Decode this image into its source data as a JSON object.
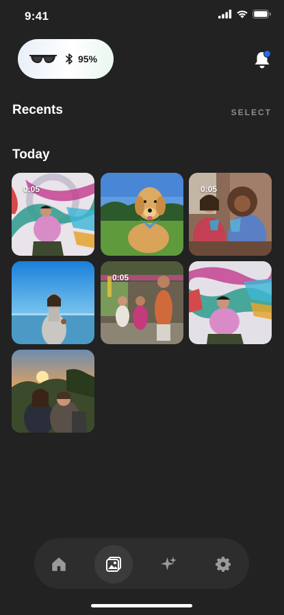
{
  "status_bar": {
    "time": "9:41"
  },
  "device": {
    "battery": "95%"
  },
  "recents": {
    "title": "Recents",
    "select_label": "SELECT"
  },
  "sections": [
    {
      "title": "Today",
      "items": [
        {
          "type": "video",
          "duration": "0:05",
          "subject": "person-with-colorful-ribbons"
        },
        {
          "type": "photo",
          "duration": "",
          "subject": "golden-retriever"
        },
        {
          "type": "video",
          "duration": "0:05",
          "subject": "friends-with-drinks"
        },
        {
          "type": "photo",
          "duration": "",
          "subject": "person-at-beach"
        },
        {
          "type": "video",
          "duration": "0:05",
          "subject": "family-dancing"
        },
        {
          "type": "photo",
          "duration": "",
          "subject": "person-with-colorful-ribbons"
        },
        {
          "type": "photo",
          "duration": "",
          "subject": "couple-at-sunset"
        }
      ]
    }
  ],
  "nav": {
    "items": [
      {
        "icon": "home-icon",
        "active": false
      },
      {
        "icon": "gallery-icon",
        "active": true
      },
      {
        "icon": "sparkle-icon",
        "active": false
      },
      {
        "icon": "gear-icon",
        "active": false
      }
    ]
  },
  "colors": {
    "background": "#222222",
    "accent_dot": "#1e6cf2",
    "nav_bg": "#2d2d2d"
  }
}
